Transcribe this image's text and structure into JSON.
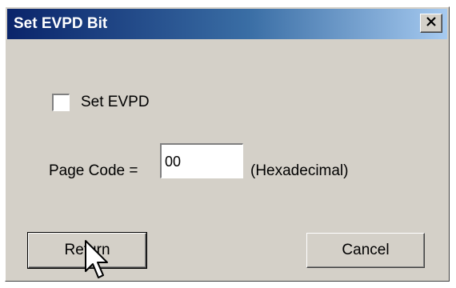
{
  "window": {
    "title": "Set EVPD Bit",
    "close_icon": "close-icon"
  },
  "form": {
    "checkbox_label": "Set EVPD",
    "checkbox_checked": false,
    "page_code_label": "Page Code =",
    "page_code_value": "00",
    "hex_label": "(Hexadecimal)"
  },
  "buttons": {
    "return_label": "Return",
    "cancel_label": "Cancel"
  },
  "cursor_icon": "mouse-pointer-icon",
  "colors": {
    "face": "#d4d0c8",
    "title_start": "#0a246a",
    "title_end": "#a6caf0"
  }
}
